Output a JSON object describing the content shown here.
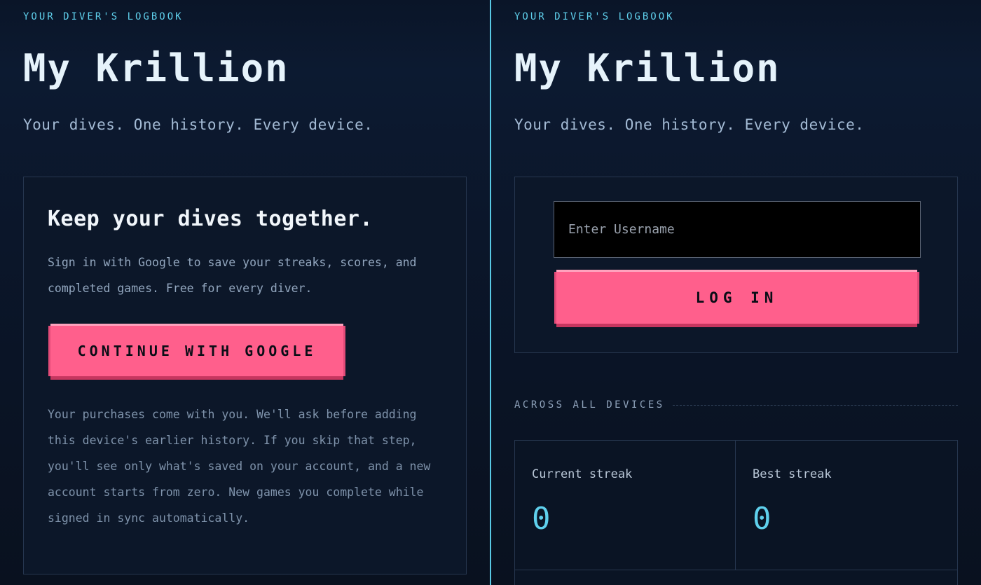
{
  "left_panel": {
    "eyebrow": "YOUR DIVER'S LOGBOOK",
    "title": "My Krillion",
    "tagline": "Your dives. One history. Every device.",
    "signin_card": {
      "heading": "Keep your dives together.",
      "intro": "Sign in with Google to save your streaks, scores, and completed games. Free for every diver.",
      "google_button_label": "CONTINUE WITH GOOGLE",
      "note": "Your purchases come with you. We'll ask before adding this device's earlier history. If you skip that step, you'll see only what's saved on your account, and a new account starts from zero. New games you complete while signed in sync automatically."
    }
  },
  "right_panel": {
    "eyebrow": "YOUR DIVER'S LOGBOOK",
    "title": "My Krillion",
    "tagline": "Your dives. One history. Every device.",
    "login_card": {
      "username_placeholder": "Enter Username",
      "username_value": "",
      "login_button_label": "LOG IN"
    },
    "stats_section_label": "ACROSS ALL DEVICES",
    "stats": [
      {
        "label": "Current streak",
        "value": "0"
      },
      {
        "label": "Best streak",
        "value": "0"
      }
    ]
  },
  "colors": {
    "accent_cyan": "#5fd0ec",
    "button_pink": "#ff5f8c",
    "background": "#0a1424"
  }
}
